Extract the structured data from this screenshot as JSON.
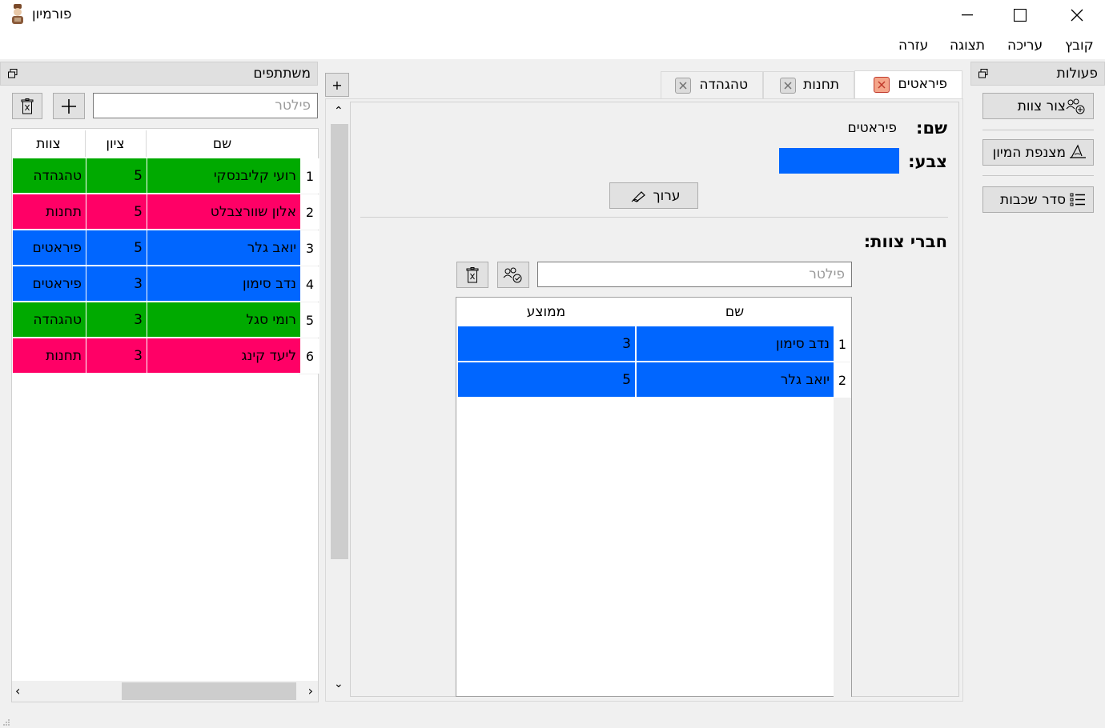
{
  "app": {
    "title": "פורמיון"
  },
  "menu": [
    "קובץ",
    "עריכה",
    "תצוגה",
    "עזרה"
  ],
  "participants_panel": {
    "title": "משתתפים",
    "filter_placeholder": "פילטר",
    "columns": {
      "name": "שם",
      "score": "ציון",
      "team": "צוות"
    },
    "rows": [
      {
        "num": "1",
        "name": "רועי קליבנסקי",
        "score": "5",
        "team": "טהגהדה",
        "color": "#00aa00"
      },
      {
        "num": "2",
        "name": "אלון שוורצבלט",
        "score": "5",
        "team": "תחנות",
        "color": "#ff0066"
      },
      {
        "num": "3",
        "name": "יואב גלר",
        "score": "5",
        "team": "פיראטים",
        "color": "#0066ff"
      },
      {
        "num": "4",
        "name": "נדב סימון",
        "score": "3",
        "team": "פיראטים",
        "color": "#0066ff"
      },
      {
        "num": "5",
        "name": "רומי סגל",
        "score": "3",
        "team": "טהגהדה",
        "color": "#00aa00"
      },
      {
        "num": "6",
        "name": "ליעד קינג",
        "score": "3",
        "team": "תחנות",
        "color": "#ff0066"
      }
    ]
  },
  "tabs": {
    "add_label": "+",
    "items": [
      {
        "label": "פיראטים",
        "active": true
      },
      {
        "label": "תחנות",
        "active": false
      },
      {
        "label": "טהגהדה",
        "active": false
      }
    ]
  },
  "team_detail": {
    "name_label": "שם:",
    "name_value": "פיראטים",
    "color_label": "צבע:",
    "color_value": "#0066ff",
    "edit_label": "ערוך",
    "members_label": "חברי צוות:",
    "filter_placeholder": "פילטר",
    "columns": {
      "name": "שם",
      "average": "ממוצע"
    },
    "rows": [
      {
        "num": "1",
        "name": "נדב סימון",
        "average": "3"
      },
      {
        "num": "2",
        "name": "יואב גלר",
        "average": "5"
      }
    ]
  },
  "actions_panel": {
    "title": "פעולות",
    "buttons": [
      "צור צוות",
      "מצנפת המיון",
      "סדר שכבות"
    ]
  }
}
